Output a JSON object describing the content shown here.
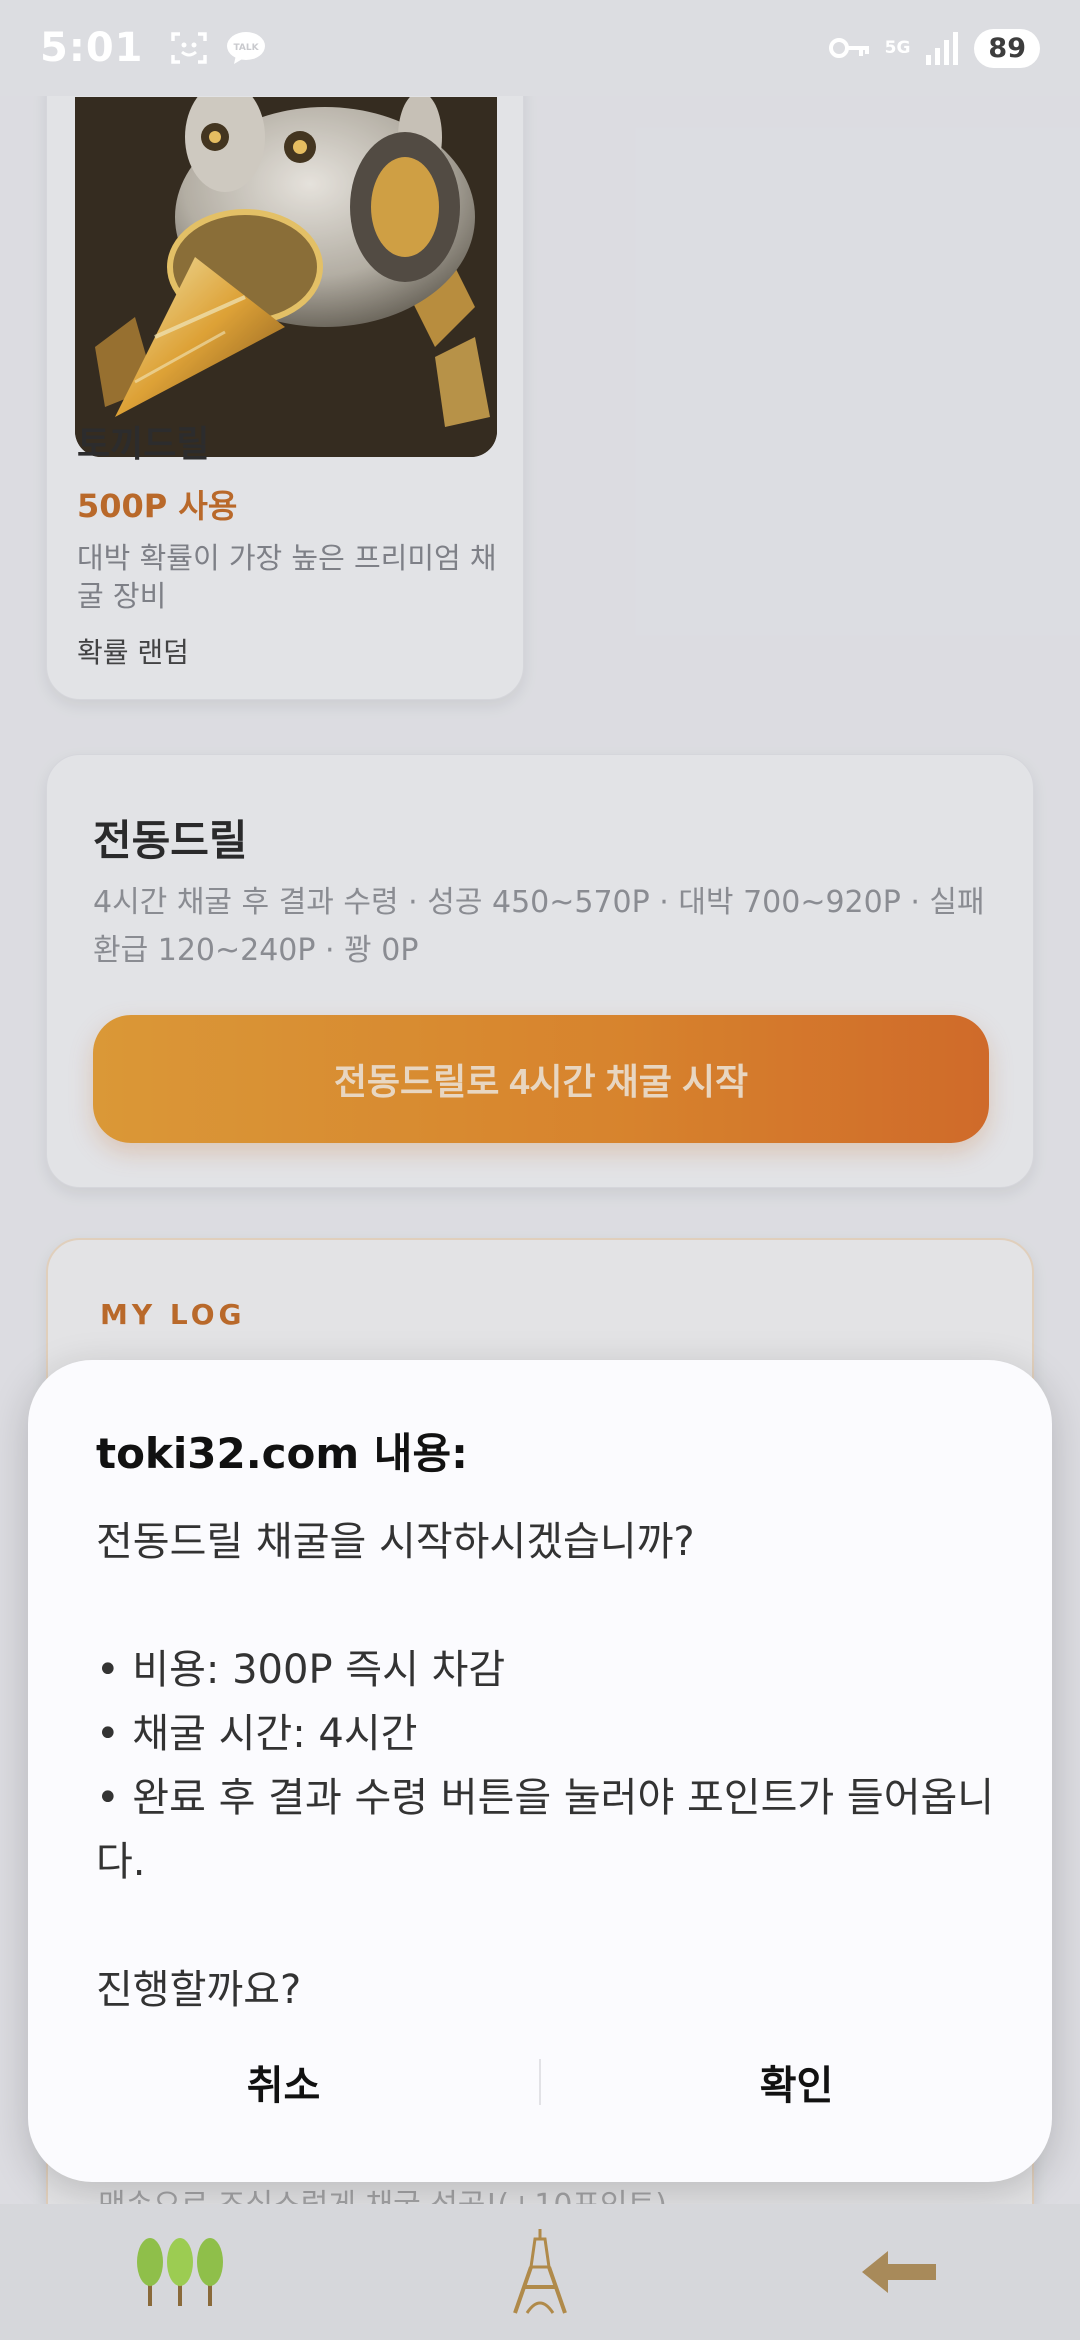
{
  "status_bar": {
    "time": "5:01",
    "network": "5G",
    "battery": "89",
    "icons": [
      "screenshot-icon",
      "kakaotalk-icon",
      "key-icon",
      "signal-icon"
    ]
  },
  "drill_card": {
    "title": "토끼드릴",
    "cost": "500P 사용",
    "description": "대박 확률이 가장 높은 프리미엄 채굴 장비",
    "chance": "확률 랜덤"
  },
  "electric_card": {
    "title": "전동드릴",
    "description": "4시간 채굴 후 결과 수령 · 성공 450~570P · 대박 700~920P · 실패 환급 120~240P · 꽝 0P",
    "start_button": "전동드릴로 4시간 채굴 시작"
  },
  "log_card": {
    "label": "MY LOG",
    "faded_entry": "맨손으로 조심스럽게 채굴 성공!(+10포인트)"
  },
  "dialog": {
    "title": "toki32.com 내용:",
    "message": "전동드릴 채굴을 시작하시겠습니까?\n\n• 비용: 300P 즉시 차감\n• 채굴 시간: 4시간\n• 완료 후 결과 수령 버튼을 눌러야 포인트가 들어옵니다.\n\n진행할까요?",
    "cancel": "취소",
    "confirm": "확인"
  },
  "bottom_nav": {
    "items": [
      "trees-icon",
      "eiffel-tower-icon",
      "back-arrow-icon"
    ]
  },
  "colors": {
    "accent": "#c0651c",
    "button_gradient_start": "#e59a2b",
    "button_gradient_end": "#d9661c"
  }
}
